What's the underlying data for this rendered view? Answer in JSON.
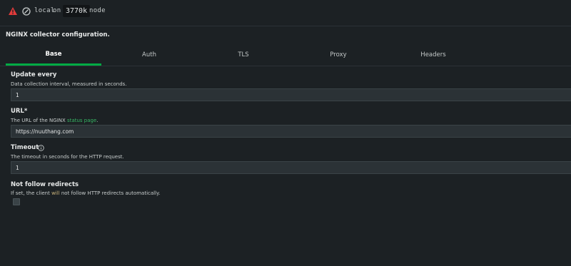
{
  "header": {
    "location": "local",
    "on_word": "on",
    "node_count": "3770k",
    "node_word": "node"
  },
  "page": {
    "title": "NGINX collector configuration."
  },
  "tabs": [
    {
      "label": "Base",
      "active": true
    },
    {
      "label": "Auth",
      "active": false
    },
    {
      "label": "TLS",
      "active": false
    },
    {
      "label": "Proxy",
      "active": false
    },
    {
      "label": "Headers",
      "active": false
    }
  ],
  "fields": {
    "update_every": {
      "label": "Update every",
      "description": "Data collection interval, measured in seconds.",
      "value": "1"
    },
    "url": {
      "label": "URL*",
      "description_prefix": "The URL of the NGINX",
      "description_link": "status page",
      "description_suffix": ".",
      "value": "https://nuuthang.com"
    },
    "timeout": {
      "label": "Timeout",
      "description": "The timeout in seconds for the HTTP request.",
      "value": "1"
    },
    "not_follow_redirects": {
      "label": "Not follow redirects",
      "description_prefix": "If set, the client",
      "description_warn": "will",
      "description_suffix": "not follow HTTP redirects automatically.",
      "checked": false
    }
  },
  "colors": {
    "background": "#1c2124",
    "accent": "#00ab44",
    "link": "#37b664",
    "warning": "#e23b3b"
  },
  "icons": {
    "warning": "warning-triangle-icon",
    "location": "globe-icon",
    "info": "info-circle-icon"
  }
}
